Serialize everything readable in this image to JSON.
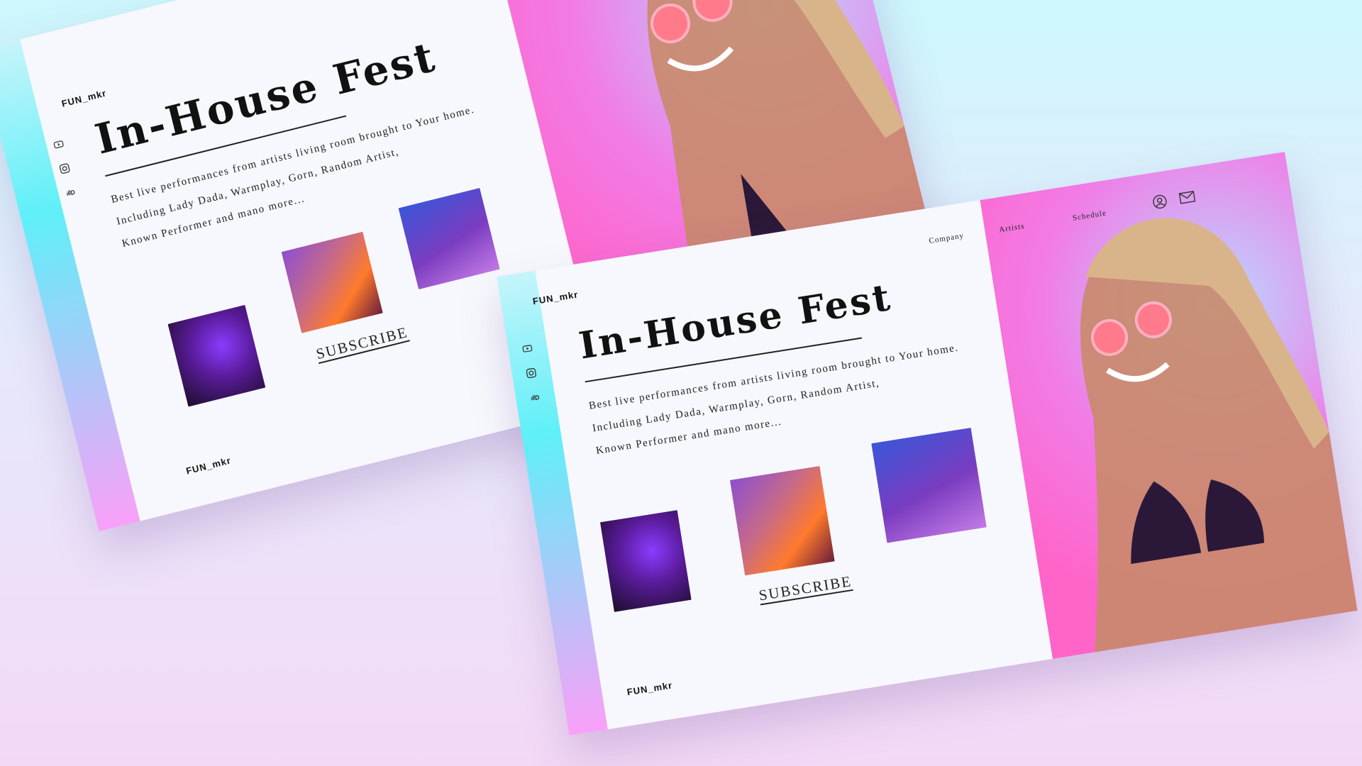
{
  "brand": "FUN_mkr",
  "hero": {
    "title": "In-House Fest",
    "description": [
      "Best live performances from artists living room brought to Your home.",
      "Including Lady Dada, Warmplay, Gorn, Random Artist,",
      "Known Performer and mano more..."
    ]
  },
  "cta": {
    "subscribe_label": "SUBSCRIBE"
  },
  "nav": {
    "company": "Company",
    "artists": "Artists",
    "schedule": "Schedule"
  },
  "social_icons": [
    "play-icon",
    "instagram-icon",
    "soundcloud-icon"
  ],
  "top_icons": [
    "user-icon",
    "mail-icon"
  ],
  "colors": {
    "accent_pink": "#f27be6",
    "accent_cyan": "#5ff0f8",
    "panel": "#f7f8fd",
    "text": "#111111"
  }
}
